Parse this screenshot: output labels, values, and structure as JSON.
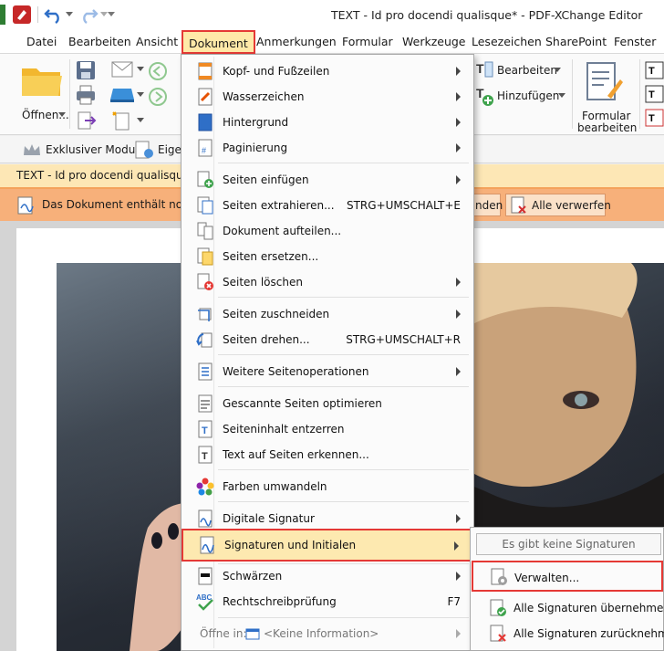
{
  "window": {
    "title": "TEXT - Id pro docendi qualisque* - PDF-XChange Editor"
  },
  "menubar": {
    "items": [
      "Datei",
      "Bearbeiten",
      "Ansicht",
      "Dokument",
      "Anmerkungen",
      "Formular",
      "Werkzeuge",
      "Lesezeichen",
      "SharePoint",
      "Fenster"
    ]
  },
  "ribbon": {
    "open_label": "Öffnen...",
    "edit_label": "Bearbeiten",
    "add_label": "Hinzufügen",
    "form_label_1": "Formular",
    "form_label_2": "bearbeiten"
  },
  "toolbar2": {
    "exclusive_label": "Exklusiver Modus",
    "eig_label": "Eige"
  },
  "tab": {
    "label": "TEXT - Id pro docendi qualisque *"
  },
  "notification": {
    "text": "Das Dokument enthält noch",
    "button_partial": "nden",
    "discard_all": "Alle verwerfen"
  },
  "dropdown": {
    "items": [
      {
        "label": "Kopf- und Fußzeilen",
        "shortcut": "",
        "arrow": true
      },
      {
        "label": "Wasserzeichen",
        "shortcut": "",
        "arrow": true
      },
      {
        "label": "Hintergrund",
        "shortcut": "",
        "arrow": true
      },
      {
        "label": "Paginierung",
        "shortcut": "",
        "arrow": true
      },
      {
        "label": "Seiten einfügen",
        "shortcut": "",
        "arrow": true
      },
      {
        "label": "Seiten extrahieren...",
        "shortcut": "STRG+UMSCHALT+E",
        "arrow": false
      },
      {
        "label": "Dokument aufteilen...",
        "shortcut": "",
        "arrow": false
      },
      {
        "label": "Seiten ersetzen...",
        "shortcut": "",
        "arrow": false
      },
      {
        "label": "Seiten löschen",
        "shortcut": "",
        "arrow": true
      },
      {
        "label": "Seiten zuschneiden",
        "shortcut": "",
        "arrow": true
      },
      {
        "label": "Seiten drehen...",
        "shortcut": "STRG+UMSCHALT+R",
        "arrow": false
      },
      {
        "label": "Weitere Seitenoperationen",
        "shortcut": "",
        "arrow": true
      },
      {
        "label": "Gescannte Seiten optimieren",
        "shortcut": "",
        "arrow": false
      },
      {
        "label": "Seiteninhalt entzerren",
        "shortcut": "",
        "arrow": false
      },
      {
        "label": "Text auf Seiten erkennen...",
        "shortcut": "",
        "arrow": false
      },
      {
        "label": "Farben umwandeln",
        "shortcut": "",
        "arrow": false
      },
      {
        "label": "Digitale Signatur",
        "shortcut": "",
        "arrow": true
      },
      {
        "label": "Signaturen und Initialen",
        "shortcut": "",
        "arrow": true
      },
      {
        "label": "Schwärzen",
        "shortcut": "",
        "arrow": true
      },
      {
        "label": "Rechtschreibprüfung",
        "shortcut": "F7",
        "arrow": false
      }
    ],
    "footer_label": "Öffne in:",
    "footer_value": "<Keine Information>"
  },
  "submenu": {
    "empty_label": "Es gibt keine Signaturen",
    "manage_label": "Verwalten...",
    "apply_all": "Alle Signaturen übernehmen",
    "revoke_all": "Alle Signaturen zurücknehmen"
  },
  "colors": {
    "highlight_border": "#e53935",
    "highlight_fill": "#fde9b0",
    "tab_fill": "#fde7b5",
    "notify_fill": "#f7b07a"
  }
}
